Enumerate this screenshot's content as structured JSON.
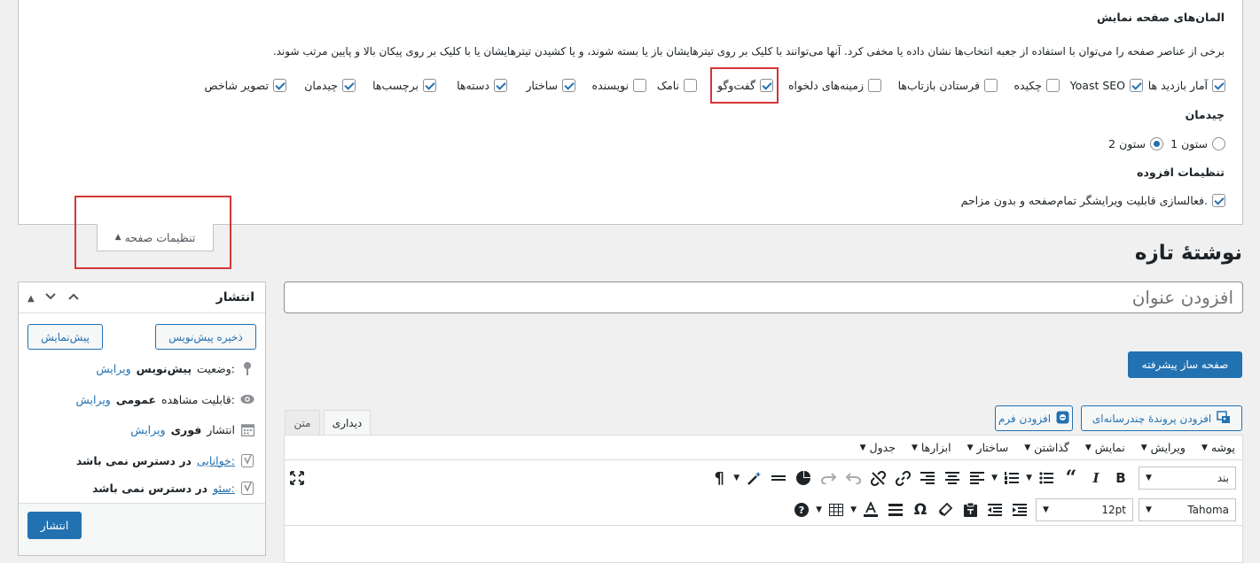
{
  "screen_options": {
    "elements_heading": "المان‌های صفحه نمایش",
    "description": "برخی از عناصر صفحه را می‌توان با استفاده از جعبه انتخاب‌ها نشان داده یا مخفی کرد. آنها می‌توانند با کلیک بر روی تیترهایشان باز یا بسته شوند، و یا کشیدن تیترهایشان یا با کلیک بر روی پیکان بالا و پایین مرتب شوند.",
    "checkboxes": [
      {
        "label": "آمار بازدید ها",
        "checked": true
      },
      {
        "label": "Yoast SEO",
        "checked": true
      },
      {
        "label": "چکیده",
        "checked": false
      },
      {
        "label": "فرستادن بازتاب‌ها",
        "checked": false
      },
      {
        "label": "زمینه‌های دلخواه",
        "checked": false
      },
      {
        "label": "گفت‌وگو",
        "checked": true
      },
      {
        "label": "نامک",
        "checked": false
      },
      {
        "label": "نویسنده",
        "checked": false
      },
      {
        "label": "ساختار",
        "checked": true
      },
      {
        "label": "دسته‌ها",
        "checked": true
      },
      {
        "label": "برچسب‌ها",
        "checked": true
      },
      {
        "label": "چیدمان",
        "checked": true
      },
      {
        "label": "تصویر شاخص",
        "checked": true
      }
    ],
    "layout_heading": "چیدمان",
    "layout_options": [
      {
        "label": "1 ستون",
        "checked": false
      },
      {
        "label": "2 ستون",
        "checked": true
      }
    ],
    "extra_heading": "تنظیمات افزوده",
    "extra_option": {
      "label": "فعالسازی قابلیت ویرایشگر تمام‌صفحه و بدون مزاحم.",
      "checked": true
    },
    "tab_label": "تنظیمات صفحه"
  },
  "page_title": "نوشتهٔ تازه",
  "publish": {
    "title": "انتشار",
    "save_draft": "ذخیره پیش‌نویس",
    "preview": "پیش‌نمایش",
    "status_label": "وضعیت:",
    "status_value": "پیش‌نویس",
    "edit": "ویرایش",
    "visibility_label": "قابلیت مشاهده:",
    "visibility_value": "عمومی",
    "publish_label": "انتشار",
    "publish_value": "فوری",
    "readability_label": "خوانایی:",
    "readability_value": "در دسترس نمی باشد",
    "seo_label": "سئو:",
    "seo_value": "در دسترس نمی باشد",
    "publish_button": "انتشار"
  },
  "editor": {
    "title_placeholder": "افزودن عنوان",
    "page_builder": "صفحه ساز پیشرفته",
    "add_media": "افزودن پروندهٔ چندرسانه‌ای",
    "add_form": "افزودن فرم",
    "tab_visual": "دیداری",
    "tab_text": "متن",
    "menus": [
      "پوشه",
      "ویرایش",
      "نمایش",
      "گذاشتن",
      "ساختار",
      "ابزارها",
      "جدول"
    ],
    "format_select": "بند",
    "font_select": "Tahoma",
    "size_select": "12pt"
  }
}
